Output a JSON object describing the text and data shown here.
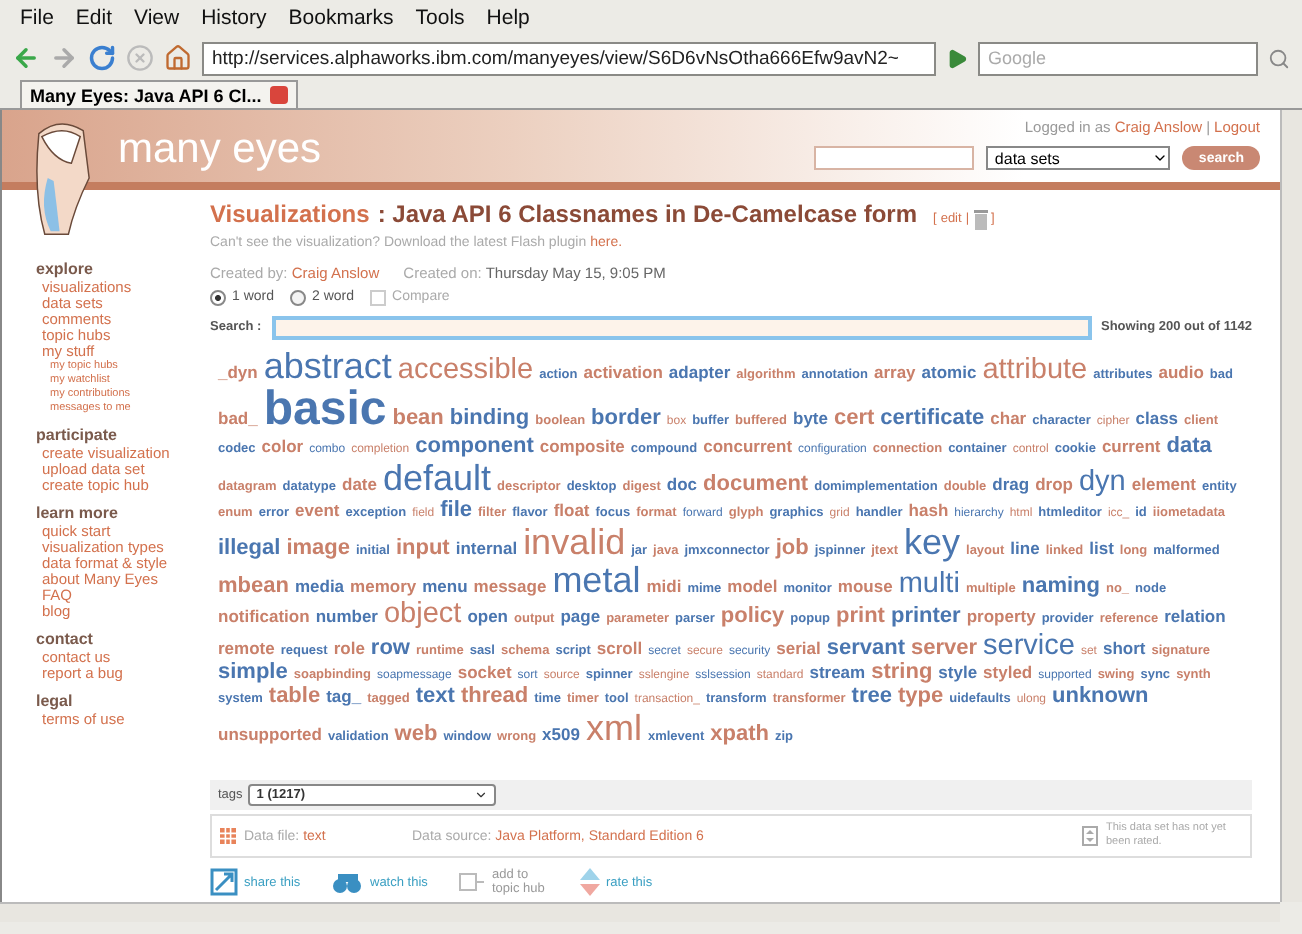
{
  "browser": {
    "menu": [
      "File",
      "Edit",
      "View",
      "History",
      "Bookmarks",
      "Tools",
      "Help"
    ],
    "url": "http://services.alphaworks.ibm.com/manyeyes/view/S6D6vNsOtha666Efw9avN2~",
    "search_placeholder": "Google",
    "tab": "Many Eyes: Java API 6 Cl..."
  },
  "header": {
    "logo": "many eyes",
    "logged_in": "Logged in as",
    "user": "Craig Anslow",
    "sep": "|",
    "logout": "Logout",
    "scope": "data sets",
    "search_button": "search"
  },
  "sidebar": [
    {
      "heading": "explore",
      "items": [
        {
          "label": "visualizations"
        },
        {
          "label": "data sets"
        },
        {
          "label": "comments"
        },
        {
          "label": "topic hubs"
        },
        {
          "label": "my stuff",
          "children": [
            {
              "label": "my topic hubs"
            },
            {
              "label": "my watchlist"
            },
            {
              "label": "my contributions"
            },
            {
              "label": "messages to me"
            }
          ]
        }
      ]
    },
    {
      "heading": "participate",
      "items": [
        {
          "label": "create visualization"
        },
        {
          "label": "upload data set"
        },
        {
          "label": "create topic hub"
        }
      ]
    },
    {
      "heading": "learn more",
      "items": [
        {
          "label": "quick start"
        },
        {
          "label": "visualization types"
        },
        {
          "label": "data format & style"
        },
        {
          "label": "about Many Eyes"
        },
        {
          "label": "FAQ"
        },
        {
          "label": "blog"
        }
      ]
    },
    {
      "heading": "contact",
      "items": [
        {
          "label": "contact us"
        },
        {
          "label": "report a bug"
        }
      ]
    },
    {
      "heading": "legal",
      "items": [
        {
          "label": "terms of use"
        }
      ]
    }
  ],
  "page": {
    "section": "Visualizations",
    "colon": ":",
    "title": "Java API 6 Classnames in De-Camelcase form",
    "edit_open": "[",
    "edit": "edit",
    "edit_sep": "|",
    "edit_close": "]",
    "flash_note": "Can't see the visualization? Download the latest Flash plugin",
    "flash_link": "here.",
    "created_by_label": "Created by:",
    "created_by": "Craig Anslow",
    "created_on_label": "Created on:",
    "created_on": "Thursday May 15, 9:05 PM"
  },
  "modes": [
    {
      "label": "1 word",
      "selected": true
    },
    {
      "label": "2 word",
      "selected": false
    }
  ],
  "compare": {
    "label": "Compare",
    "checked": false,
    "disabled": true
  },
  "search_label": "Search :",
  "showing": "Showing 200 out of 1142",
  "words": [
    {
      "text": "_dyn",
      "kind": "m",
      "color": "#c9806a"
    },
    {
      "text": "abstract",
      "kind": "xx",
      "color": "#4a76b0"
    },
    {
      "text": "accessible",
      "kind": "x",
      "color": "#c9806a"
    },
    {
      "text": "action",
      "kind": "s",
      "color": "#4a76b0"
    },
    {
      "text": "activation",
      "kind": "m",
      "color": "#c9806a"
    },
    {
      "text": "adapter",
      "kind": "m",
      "color": "#4a76b0"
    },
    {
      "text": "algorithm",
      "kind": "s",
      "color": "#c9806a"
    },
    {
      "text": "annotation",
      "kind": "s",
      "color": "#4a76b0"
    },
    {
      "text": "array",
      "kind": "m",
      "color": "#c9806a"
    },
    {
      "text": "atomic",
      "kind": "m",
      "color": "#4a76b0"
    },
    {
      "text": "attribute",
      "kind": "x",
      "color": "#c9806a"
    },
    {
      "text": "attributes",
      "kind": "s",
      "color": "#4a76b0"
    },
    {
      "text": "audio",
      "kind": "m",
      "color": "#c9806a"
    },
    {
      "text": "bad",
      "kind": "s",
      "color": "#4a76b0"
    },
    {
      "text": "bad_",
      "kind": "m",
      "color": "#c9806a"
    },
    {
      "text": "basic",
      "kind": "g",
      "color": "#4a76b0"
    },
    {
      "text": "bean",
      "kind": "l",
      "color": "#c9806a"
    },
    {
      "text": "binding",
      "kind": "l",
      "color": "#4a76b0"
    },
    {
      "text": "boolean",
      "kind": "s",
      "color": "#c9806a"
    },
    {
      "text": "border",
      "kind": "l",
      "color": "#4a76b0"
    },
    {
      "text": "box",
      "kind": "t",
      "color": "#c9806a"
    },
    {
      "text": "buffer",
      "kind": "s",
      "color": "#4a76b0"
    },
    {
      "text": "buffered",
      "kind": "s",
      "color": "#c9806a"
    },
    {
      "text": "byte",
      "kind": "m",
      "color": "#4a76b0"
    },
    {
      "text": "cert",
      "kind": "l",
      "color": "#c9806a"
    },
    {
      "text": "certificate",
      "kind": "l",
      "color": "#4a76b0"
    },
    {
      "text": "char",
      "kind": "m",
      "color": "#c9806a"
    },
    {
      "text": "character",
      "kind": "s",
      "color": "#4a76b0"
    },
    {
      "text": "cipher",
      "kind": "t",
      "color": "#c9806a"
    },
    {
      "text": "class",
      "kind": "m",
      "color": "#4a76b0"
    },
    {
      "text": "client",
      "kind": "s",
      "color": "#c9806a"
    },
    {
      "text": "codec",
      "kind": "s",
      "color": "#4a76b0"
    },
    {
      "text": "color",
      "kind": "m",
      "color": "#c9806a"
    },
    {
      "text": "combo",
      "kind": "t",
      "color": "#4a76b0"
    },
    {
      "text": "completion",
      "kind": "t",
      "color": "#c9806a"
    },
    {
      "text": "component",
      "kind": "l",
      "color": "#4a76b0"
    },
    {
      "text": "composite",
      "kind": "m",
      "color": "#c9806a"
    },
    {
      "text": "compound",
      "kind": "s",
      "color": "#4a76b0"
    },
    {
      "text": "concurrent",
      "kind": "m",
      "color": "#c9806a"
    },
    {
      "text": "configuration",
      "kind": "t",
      "color": "#4a76b0"
    },
    {
      "text": "connection",
      "kind": "s",
      "color": "#c9806a"
    },
    {
      "text": "container",
      "kind": "s",
      "color": "#4a76b0"
    },
    {
      "text": "control",
      "kind": "t",
      "color": "#c9806a"
    },
    {
      "text": "cookie",
      "kind": "s",
      "color": "#4a76b0"
    },
    {
      "text": "current",
      "kind": "m",
      "color": "#c9806a"
    },
    {
      "text": "data",
      "kind": "l",
      "color": "#4a76b0"
    },
    {
      "text": "datagram",
      "kind": "s",
      "color": "#c9806a"
    },
    {
      "text": "datatype",
      "kind": "s",
      "color": "#4a76b0"
    },
    {
      "text": "date",
      "kind": "m",
      "color": "#c9806a"
    },
    {
      "text": "default",
      "kind": "xx",
      "color": "#4a76b0"
    },
    {
      "text": "descriptor",
      "kind": "s",
      "color": "#c9806a"
    },
    {
      "text": "desktop",
      "kind": "s",
      "color": "#4a76b0"
    },
    {
      "text": "digest",
      "kind": "s",
      "color": "#c9806a"
    },
    {
      "text": "doc",
      "kind": "m",
      "color": "#4a76b0"
    },
    {
      "text": "document",
      "kind": "l",
      "color": "#c9806a"
    },
    {
      "text": "domimplementation",
      "kind": "s",
      "color": "#4a76b0"
    },
    {
      "text": "double",
      "kind": "s",
      "color": "#c9806a"
    },
    {
      "text": "drag",
      "kind": "m",
      "color": "#4a76b0"
    },
    {
      "text": "drop",
      "kind": "m",
      "color": "#c9806a"
    },
    {
      "text": "dyn",
      "kind": "x",
      "color": "#4a76b0"
    },
    {
      "text": "element",
      "kind": "m",
      "color": "#c9806a"
    },
    {
      "text": "entity",
      "kind": "s",
      "color": "#4a76b0"
    },
    {
      "text": "enum",
      "kind": "s",
      "color": "#c9806a"
    },
    {
      "text": "error",
      "kind": "s",
      "color": "#4a76b0"
    },
    {
      "text": "event",
      "kind": "m",
      "color": "#c9806a"
    },
    {
      "text": "exception",
      "kind": "s",
      "color": "#4a76b0"
    },
    {
      "text": "field",
      "kind": "t",
      "color": "#c9806a"
    },
    {
      "text": "file",
      "kind": "l",
      "color": "#4a76b0"
    },
    {
      "text": "filter",
      "kind": "s",
      "color": "#c9806a"
    },
    {
      "text": "flavor",
      "kind": "s",
      "color": "#4a76b0"
    },
    {
      "text": "float",
      "kind": "m",
      "color": "#c9806a"
    },
    {
      "text": "focus",
      "kind": "s",
      "color": "#4a76b0"
    },
    {
      "text": "format",
      "kind": "s",
      "color": "#c9806a"
    },
    {
      "text": "forward",
      "kind": "t",
      "color": "#4a76b0"
    },
    {
      "text": "glyph",
      "kind": "s",
      "color": "#c9806a"
    },
    {
      "text": "graphics",
      "kind": "s",
      "color": "#4a76b0"
    },
    {
      "text": "grid",
      "kind": "t",
      "color": "#c9806a"
    },
    {
      "text": "handler",
      "kind": "s",
      "color": "#4a76b0"
    },
    {
      "text": "hash",
      "kind": "m",
      "color": "#c9806a"
    },
    {
      "text": "hierarchy",
      "kind": "t",
      "color": "#4a76b0"
    },
    {
      "text": "html",
      "kind": "t",
      "color": "#c9806a"
    },
    {
      "text": "htmleditor",
      "kind": "s",
      "color": "#4a76b0"
    },
    {
      "text": "icc_",
      "kind": "t",
      "color": "#c9806a"
    },
    {
      "text": "id",
      "kind": "s",
      "color": "#4a76b0"
    },
    {
      "text": "iiometadata",
      "kind": "s",
      "color": "#c9806a"
    },
    {
      "text": "illegal",
      "kind": "l",
      "color": "#4a76b0"
    },
    {
      "text": "image",
      "kind": "l",
      "color": "#c9806a"
    },
    {
      "text": "initial",
      "kind": "s",
      "color": "#4a76b0"
    },
    {
      "text": "input",
      "kind": "l",
      "color": "#c9806a"
    },
    {
      "text": "internal",
      "kind": "m",
      "color": "#4a76b0"
    },
    {
      "text": "invalid",
      "kind": "xx",
      "color": "#c9806a"
    },
    {
      "text": "jar",
      "kind": "s",
      "color": "#4a76b0"
    },
    {
      "text": "java",
      "kind": "s",
      "color": "#c9806a"
    },
    {
      "text": "jmxconnector",
      "kind": "s",
      "color": "#4a76b0"
    },
    {
      "text": "job",
      "kind": "l",
      "color": "#c9806a"
    },
    {
      "text": "jspinner",
      "kind": "s",
      "color": "#4a76b0"
    },
    {
      "text": "jtext",
      "kind": "s",
      "color": "#c9806a"
    },
    {
      "text": "key",
      "kind": "xx",
      "color": "#4a76b0"
    },
    {
      "text": "layout",
      "kind": "s",
      "color": "#c9806a"
    },
    {
      "text": "line",
      "kind": "m",
      "color": "#4a76b0"
    },
    {
      "text": "linked",
      "kind": "s",
      "color": "#c9806a"
    },
    {
      "text": "list",
      "kind": "m",
      "color": "#4a76b0"
    },
    {
      "text": "long",
      "kind": "s",
      "color": "#c9806a"
    },
    {
      "text": "malformed",
      "kind": "s",
      "color": "#4a76b0"
    },
    {
      "text": "mbean",
      "kind": "l",
      "color": "#c9806a"
    },
    {
      "text": "media",
      "kind": "m",
      "color": "#4a76b0"
    },
    {
      "text": "memory",
      "kind": "m",
      "color": "#c9806a"
    },
    {
      "text": "menu",
      "kind": "m",
      "color": "#4a76b0"
    },
    {
      "text": "message",
      "kind": "m",
      "color": "#c9806a"
    },
    {
      "text": "metal",
      "kind": "xx",
      "color": "#4a76b0"
    },
    {
      "text": "midi",
      "kind": "m",
      "color": "#c9806a"
    },
    {
      "text": "mime",
      "kind": "s",
      "color": "#4a76b0"
    },
    {
      "text": "model",
      "kind": "m",
      "color": "#c9806a"
    },
    {
      "text": "monitor",
      "kind": "s",
      "color": "#4a76b0"
    },
    {
      "text": "mouse",
      "kind": "m",
      "color": "#c9806a"
    },
    {
      "text": "multi",
      "kind": "x",
      "color": "#4a76b0"
    },
    {
      "text": "multiple",
      "kind": "s",
      "color": "#c9806a"
    },
    {
      "text": "naming",
      "kind": "l",
      "color": "#4a76b0"
    },
    {
      "text": "no_",
      "kind": "s",
      "color": "#c9806a"
    },
    {
      "text": "node",
      "kind": "s",
      "color": "#4a76b0"
    },
    {
      "text": "notification",
      "kind": "m",
      "color": "#c9806a"
    },
    {
      "text": "number",
      "kind": "m",
      "color": "#4a76b0"
    },
    {
      "text": "object",
      "kind": "x",
      "color": "#c9806a"
    },
    {
      "text": "open",
      "kind": "m",
      "color": "#4a76b0"
    },
    {
      "text": "output",
      "kind": "s",
      "color": "#c9806a"
    },
    {
      "text": "page",
      "kind": "m",
      "color": "#4a76b0"
    },
    {
      "text": "parameter",
      "kind": "s",
      "color": "#c9806a"
    },
    {
      "text": "parser",
      "kind": "s",
      "color": "#4a76b0"
    },
    {
      "text": "policy",
      "kind": "l",
      "color": "#c9806a"
    },
    {
      "text": "popup",
      "kind": "s",
      "color": "#4a76b0"
    },
    {
      "text": "print",
      "kind": "l",
      "color": "#c9806a"
    },
    {
      "text": "printer",
      "kind": "l",
      "color": "#4a76b0"
    },
    {
      "text": "property",
      "kind": "m",
      "color": "#c9806a"
    },
    {
      "text": "provider",
      "kind": "s",
      "color": "#4a76b0"
    },
    {
      "text": "reference",
      "kind": "s",
      "color": "#c9806a"
    },
    {
      "text": "relation",
      "kind": "m",
      "color": "#4a76b0"
    },
    {
      "text": "remote",
      "kind": "m",
      "color": "#c9806a"
    },
    {
      "text": "request",
      "kind": "s",
      "color": "#4a76b0"
    },
    {
      "text": "role",
      "kind": "m",
      "color": "#c9806a"
    },
    {
      "text": "row",
      "kind": "l",
      "color": "#4a76b0"
    },
    {
      "text": "runtime",
      "kind": "s",
      "color": "#c9806a"
    },
    {
      "text": "sasl",
      "kind": "s",
      "color": "#4a76b0"
    },
    {
      "text": "schema",
      "kind": "s",
      "color": "#c9806a"
    },
    {
      "text": "script",
      "kind": "s",
      "color": "#4a76b0"
    },
    {
      "text": "scroll",
      "kind": "m",
      "color": "#c9806a"
    },
    {
      "text": "secret",
      "kind": "t",
      "color": "#4a76b0"
    },
    {
      "text": "secure",
      "kind": "t",
      "color": "#c9806a"
    },
    {
      "text": "security",
      "kind": "t",
      "color": "#4a76b0"
    },
    {
      "text": "serial",
      "kind": "m",
      "color": "#c9806a"
    },
    {
      "text": "servant",
      "kind": "l",
      "color": "#4a76b0"
    },
    {
      "text": "server",
      "kind": "l",
      "color": "#c9806a"
    },
    {
      "text": "service",
      "kind": "x",
      "color": "#4a76b0"
    },
    {
      "text": "set",
      "kind": "t",
      "color": "#c9806a"
    },
    {
      "text": "short",
      "kind": "m",
      "color": "#4a76b0"
    },
    {
      "text": "signature",
      "kind": "s",
      "color": "#c9806a"
    },
    {
      "text": "simple",
      "kind": "l",
      "color": "#4a76b0"
    },
    {
      "text": "soapbinding",
      "kind": "s",
      "color": "#c9806a"
    },
    {
      "text": "soapmessage",
      "kind": "t",
      "color": "#4a76b0"
    },
    {
      "text": "socket",
      "kind": "m",
      "color": "#c9806a"
    },
    {
      "text": "sort",
      "kind": "t",
      "color": "#4a76b0"
    },
    {
      "text": "source",
      "kind": "t",
      "color": "#c9806a"
    },
    {
      "text": "spinner",
      "kind": "s",
      "color": "#4a76b0"
    },
    {
      "text": "sslengine",
      "kind": "t",
      "color": "#c9806a"
    },
    {
      "text": "sslsession",
      "kind": "t",
      "color": "#4a76b0"
    },
    {
      "text": "standard",
      "kind": "t",
      "color": "#c9806a"
    },
    {
      "text": "stream",
      "kind": "m",
      "color": "#4a76b0"
    },
    {
      "text": "string",
      "kind": "l",
      "color": "#c9806a"
    },
    {
      "text": "style",
      "kind": "m",
      "color": "#4a76b0"
    },
    {
      "text": "styled",
      "kind": "m",
      "color": "#c9806a"
    },
    {
      "text": "supported",
      "kind": "t",
      "color": "#4a76b0"
    },
    {
      "text": "swing",
      "kind": "s",
      "color": "#c9806a"
    },
    {
      "text": "sync",
      "kind": "s",
      "color": "#4a76b0"
    },
    {
      "text": "synth",
      "kind": "s",
      "color": "#c9806a"
    },
    {
      "text": "system",
      "kind": "s",
      "color": "#4a76b0"
    },
    {
      "text": "table",
      "kind": "l",
      "color": "#c9806a"
    },
    {
      "text": "tag_",
      "kind": "m",
      "color": "#4a76b0"
    },
    {
      "text": "tagged",
      "kind": "s",
      "color": "#c9806a"
    },
    {
      "text": "text",
      "kind": "l",
      "color": "#4a76b0"
    },
    {
      "text": "thread",
      "kind": "l",
      "color": "#c9806a"
    },
    {
      "text": "time",
      "kind": "s",
      "color": "#4a76b0"
    },
    {
      "text": "timer",
      "kind": "s",
      "color": "#c9806a"
    },
    {
      "text": "tool",
      "kind": "s",
      "color": "#4a76b0"
    },
    {
      "text": "transaction_",
      "kind": "t",
      "color": "#c9806a"
    },
    {
      "text": "transform",
      "kind": "s",
      "color": "#4a76b0"
    },
    {
      "text": "transformer",
      "kind": "s",
      "color": "#c9806a"
    },
    {
      "text": "tree",
      "kind": "l",
      "color": "#4a76b0"
    },
    {
      "text": "type",
      "kind": "l",
      "color": "#c9806a"
    },
    {
      "text": "uidefaults",
      "kind": "s",
      "color": "#4a76b0"
    },
    {
      "text": "ulong",
      "kind": "t",
      "color": "#c9806a"
    },
    {
      "text": "unknown",
      "kind": "l",
      "color": "#4a76b0"
    },
    {
      "text": "unsupported",
      "kind": "m",
      "color": "#c9806a"
    },
    {
      "text": "validation",
      "kind": "s",
      "color": "#4a76b0"
    },
    {
      "text": "web",
      "kind": "l",
      "color": "#c9806a"
    },
    {
      "text": "window",
      "kind": "s",
      "color": "#4a76b0"
    },
    {
      "text": "wrong",
      "kind": "s",
      "color": "#c9806a"
    },
    {
      "text": "x509",
      "kind": "m",
      "color": "#4a76b0"
    },
    {
      "text": "xml",
      "kind": "xx",
      "color": "#c9806a"
    },
    {
      "text": "xmlevent",
      "kind": "s",
      "color": "#4a76b0"
    },
    {
      "text": "xpath",
      "kind": "l",
      "color": "#c9806a"
    },
    {
      "text": "zip",
      "kind": "s",
      "color": "#4a76b0"
    }
  ],
  "tags": {
    "label": "tags",
    "value": "1 (1217)"
  },
  "data_info": {
    "file_label": "Data file:",
    "file": "text",
    "source_label": "Data source:",
    "source": "Java Platform, Standard Edition 6",
    "rating": "This data set has not yet been rated."
  },
  "actions": [
    {
      "label": "share this",
      "kind": "share",
      "disabled": false
    },
    {
      "label": "watch this",
      "kind": "watch",
      "disabled": false
    },
    {
      "label": "add to topic hub",
      "kind": "hub",
      "disabled": true
    },
    {
      "label": "rate this",
      "kind": "rate",
      "disabled": false
    }
  ]
}
